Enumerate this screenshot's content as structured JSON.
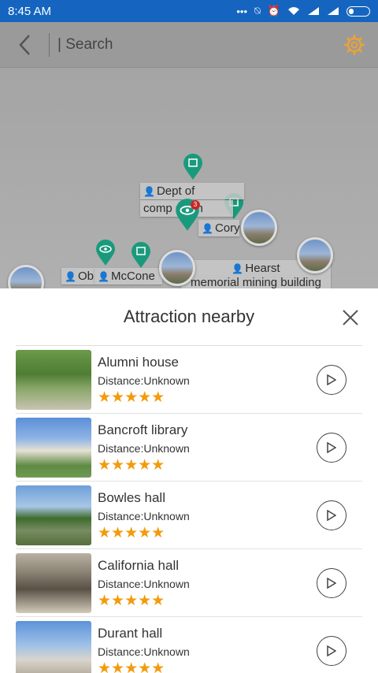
{
  "status_bar": {
    "time": "8:45 AM",
    "icons": [
      "dots-icon",
      "mute-icon",
      "alarm-icon",
      "wifi-icon",
      "signal-icon",
      "signal-icon",
      "battery-icon"
    ]
  },
  "toolbar": {
    "back_icon": "chevron-left-icon",
    "search_placeholder": "| Search",
    "settings_icon": "gear-icon",
    "accent": "#e8a33a"
  },
  "map": {
    "labels": [
      {
        "id": "dept",
        "text": "Dept of"
      },
      {
        "id": "comp",
        "text": "comp"
      },
      {
        "id": "scien",
        "text": "scien"
      },
      {
        "id": "cory",
        "text": "Cory"
      },
      {
        "id": "ob",
        "text": "Ob"
      },
      {
        "id": "mccone",
        "text": "McCone"
      },
      {
        "id": "hearst1",
        "text": "Hearst"
      },
      {
        "id": "hearst2",
        "text": "memorial mining building"
      }
    ],
    "cluster_badge": "3",
    "pin_color": "#1a9a7c"
  },
  "panel": {
    "title": "Attraction nearby",
    "close_icon": "close-icon",
    "items": [
      {
        "name": "Alumni house",
        "distance": "Distance:Unknown",
        "stars": "★★★★★"
      },
      {
        "name": "Bancroft library",
        "distance": "Distance:Unknown",
        "stars": "★★★★★"
      },
      {
        "name": "Bowles hall",
        "distance": "Distance:Unknown",
        "stars": "★★★★★"
      },
      {
        "name": "California hall",
        "distance": "Distance:Unknown",
        "stars": "★★★★★"
      },
      {
        "name": "Durant hall",
        "distance": "Distance:Unknown",
        "stars": "★★★★★"
      }
    ],
    "star_color": "#f29b0c"
  }
}
